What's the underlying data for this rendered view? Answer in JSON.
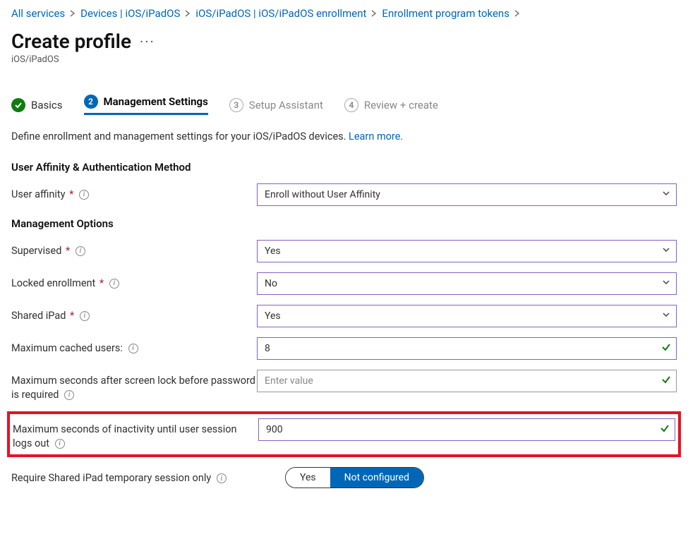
{
  "breadcrumb": [
    {
      "label": "All services"
    },
    {
      "label": "Devices | iOS/iPadOS"
    },
    {
      "label": "iOS/iPadOS | iOS/iPadOS enrollment"
    },
    {
      "label": "Enrollment program tokens"
    }
  ],
  "title": "Create profile",
  "subtitle": "iOS/iPadOS",
  "steps": [
    {
      "label": "Basics",
      "state": "done"
    },
    {
      "num": "2",
      "label": "Management Settings",
      "state": "current"
    },
    {
      "num": "3",
      "label": "Setup Assistant",
      "state": "pending"
    },
    {
      "num": "4",
      "label": "Review + create",
      "state": "pending"
    }
  ],
  "description_text": "Define enrollment and management settings for your iOS/iPadOS devices. ",
  "learn_more": "Learn more.",
  "sections": {
    "affinity_heading": "User Affinity & Authentication Method",
    "management_heading": "Management Options"
  },
  "fields": {
    "user_affinity": {
      "label": "User affinity",
      "value": "Enroll without User Affinity"
    },
    "supervised": {
      "label": "Supervised",
      "value": "Yes"
    },
    "locked_enrollment": {
      "label": "Locked enrollment",
      "value": "No"
    },
    "shared_ipad": {
      "label": "Shared iPad",
      "value": "Yes"
    },
    "max_cached_users": {
      "label": "Maximum cached users:",
      "value": "8"
    },
    "max_seconds_lock": {
      "label": "Maximum seconds after screen lock before password is required",
      "placeholder": "Enter value",
      "value": ""
    },
    "max_inactivity": {
      "label": "Maximum seconds of inactivity until user session logs out",
      "value": "900"
    },
    "require_temp_session": {
      "label": "Require Shared iPad temporary session only",
      "options": {
        "yes": "Yes",
        "not_configured": "Not configured"
      },
      "selected": "not_configured"
    }
  }
}
